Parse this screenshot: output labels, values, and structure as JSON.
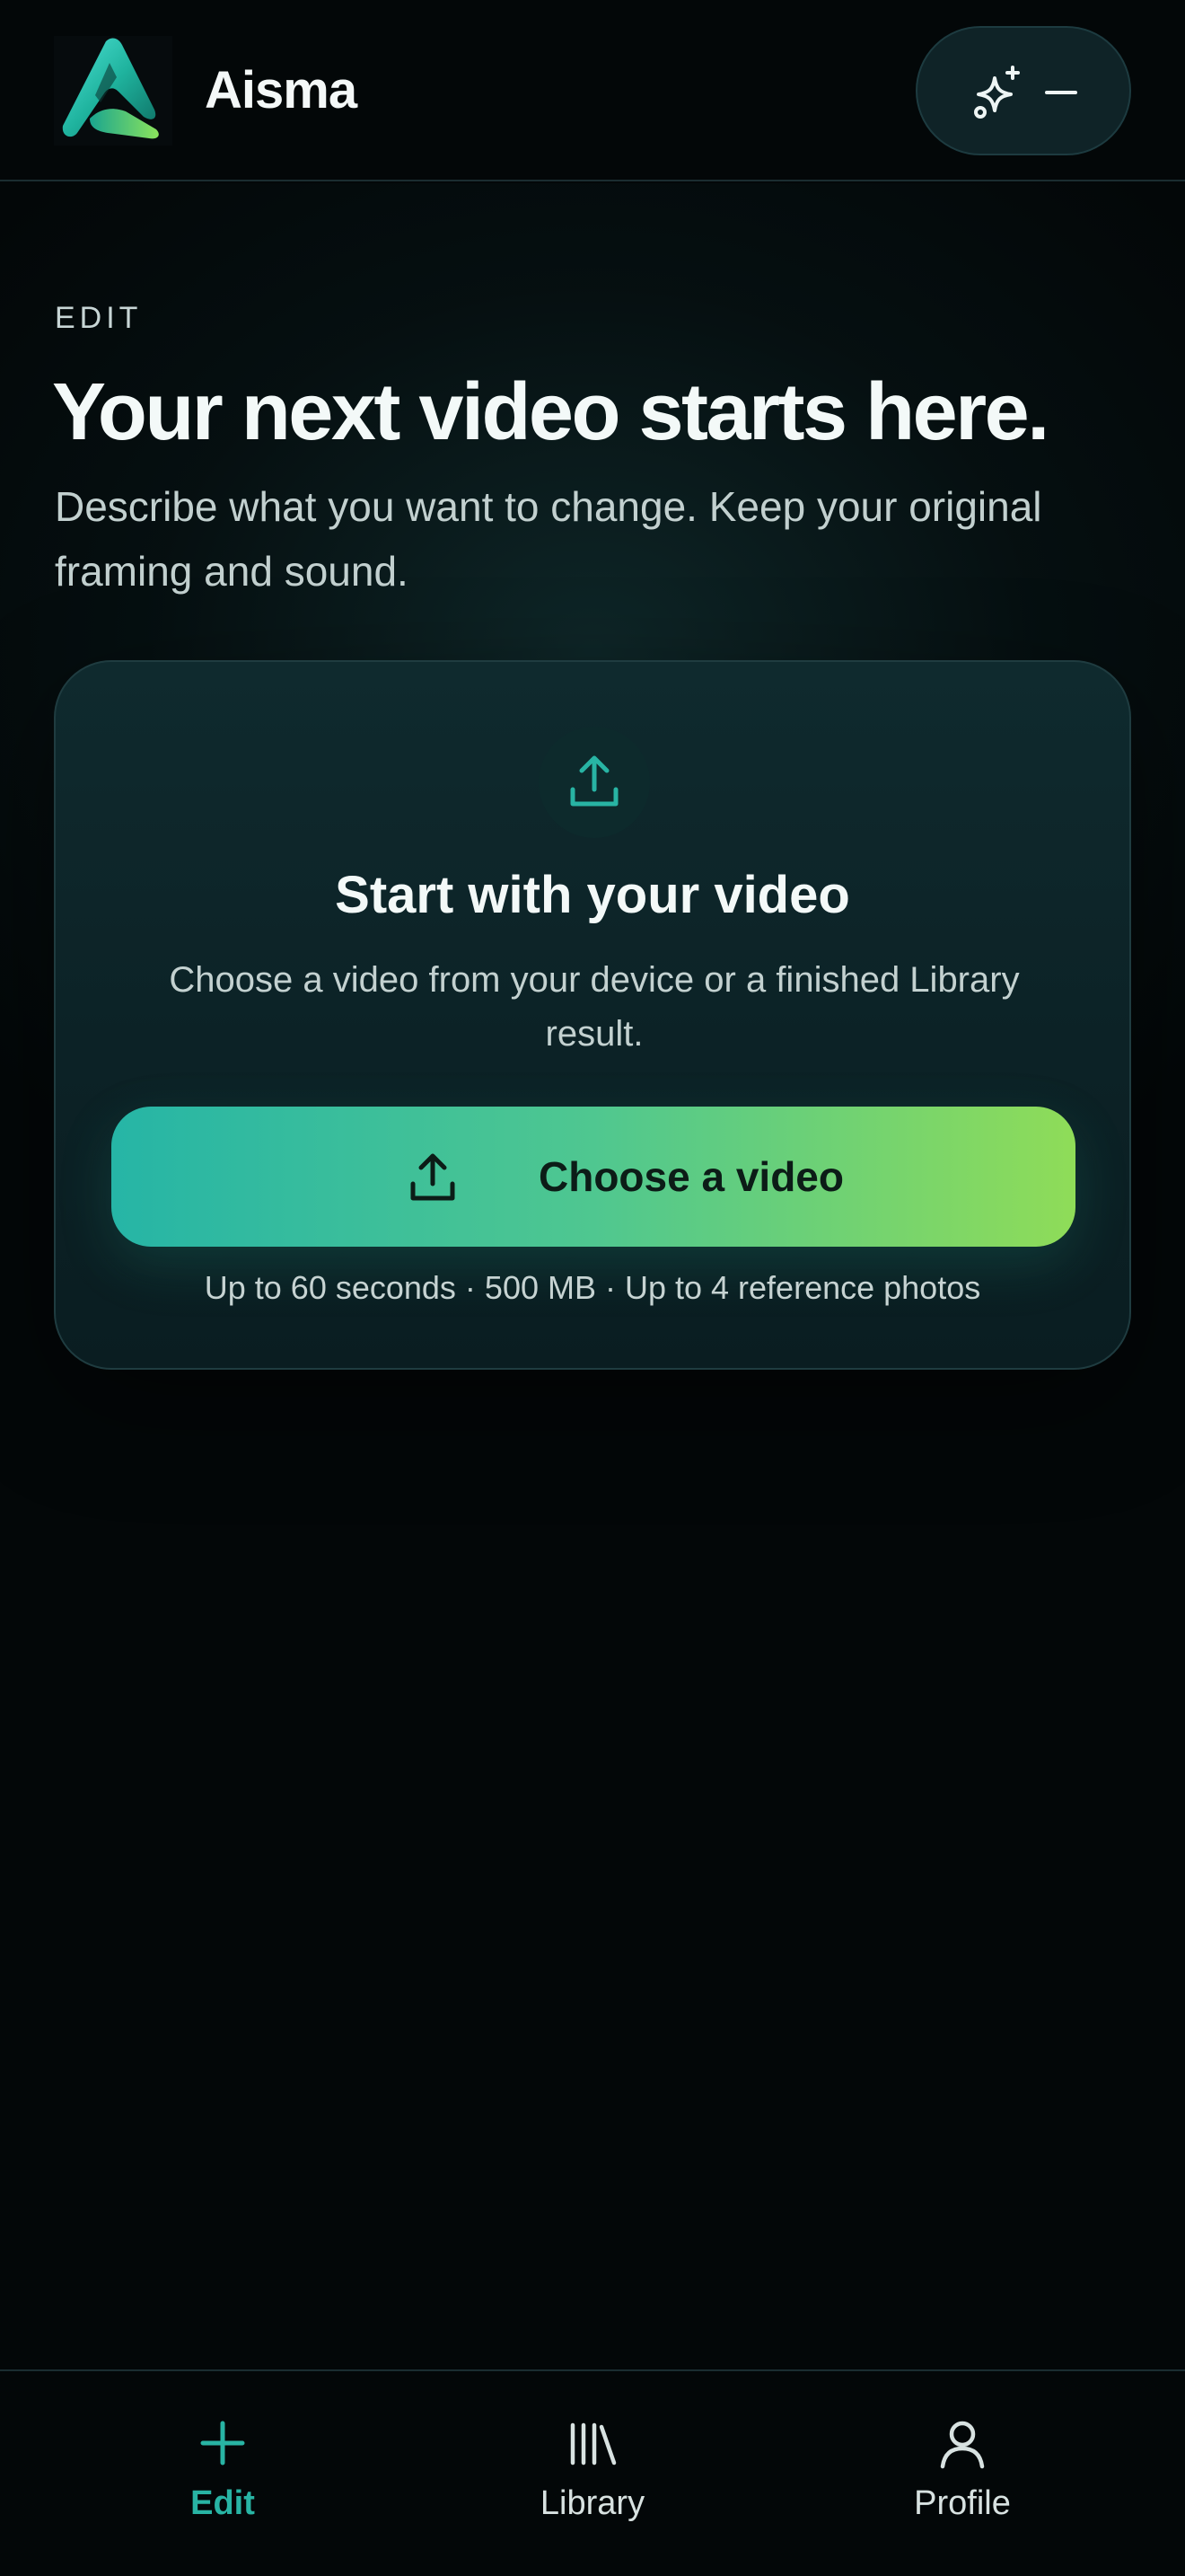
{
  "app": {
    "name": "Aisma",
    "logo_icon": "aisma-logo-icon"
  },
  "header": {
    "menu_button": {
      "icons": [
        "sparkle-icon",
        "minus-icon"
      ]
    }
  },
  "hero": {
    "eyebrow": "EDIT",
    "title": "Your next video starts here.",
    "subtitle": "Describe what you want to change. Keep your original framing and sound."
  },
  "upload_card": {
    "icon": "upload-icon",
    "title": "Start with your video",
    "description": "Choose a video from your device or a finished Library result.",
    "button_label": "Choose a video",
    "limits": "Up to 60 seconds · 500 MB · Up to 4 reference photos"
  },
  "bottom_nav": {
    "items": [
      {
        "label": "Edit",
        "icon": "plus-icon",
        "active": true
      },
      {
        "label": "Library",
        "icon": "library-icon",
        "active": false
      },
      {
        "label": "Profile",
        "icon": "user-icon",
        "active": false
      }
    ]
  },
  "colors": {
    "background": "#030708",
    "accent": "#28b4a4",
    "gradient_start": "#26b5a6",
    "gradient_end": "#8fdc58",
    "card": "#0f2a2e"
  }
}
